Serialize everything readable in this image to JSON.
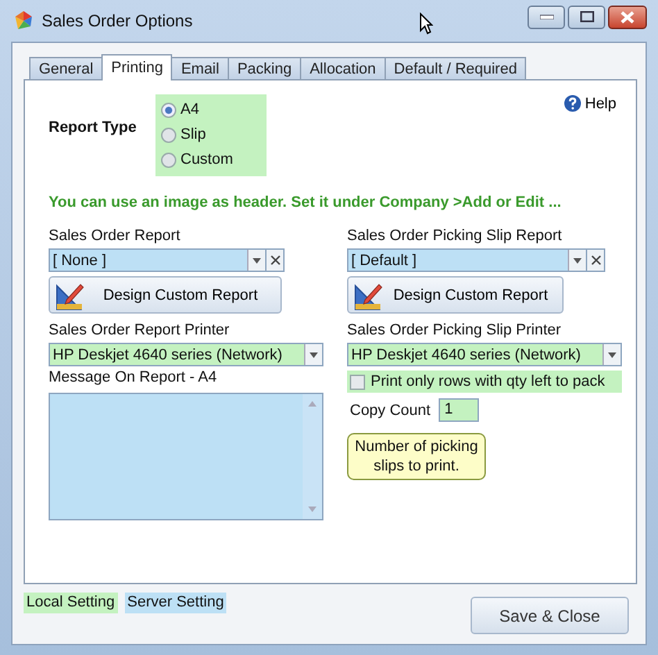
{
  "window": {
    "title": "Sales Order Options"
  },
  "tabs": [
    {
      "label": "General",
      "selected": false
    },
    {
      "label": "Printing",
      "selected": true
    },
    {
      "label": "Email",
      "selected": false
    },
    {
      "label": "Packing",
      "selected": false
    },
    {
      "label": "Allocation",
      "selected": false
    },
    {
      "label": "Default / Required",
      "selected": false
    }
  ],
  "help": {
    "label": "Help"
  },
  "report_type": {
    "label": "Report Type",
    "color": "#c4f2c0",
    "options": [
      {
        "label": "A4",
        "selected": true
      },
      {
        "label": "Slip",
        "selected": false
      },
      {
        "label": "Custom",
        "selected": false
      }
    ]
  },
  "header_hint": "You can use an image as header. Set it under  Company >Add or Edit ...",
  "left": {
    "report": {
      "label": "Sales Order Report",
      "value": "[ None ]",
      "color": "#bde0f5"
    },
    "design_button": "Design Custom Report",
    "printer": {
      "label": "Sales Order Report Printer",
      "value": "HP Deskjet 4640 series (Network)",
      "color": "#c4f2c0"
    },
    "message": {
      "label": "Message On Report - A4",
      "color": "#bde0f5"
    }
  },
  "right": {
    "report": {
      "label": "Sales Order Picking Slip Report",
      "value": "[ Default ]",
      "color": "#bde0f5"
    },
    "design_button": "Design Custom Report",
    "printer": {
      "label": "Sales Order Picking Slip Printer",
      "value": "HP Deskjet 4640 series (Network)",
      "color": "#c4f2c0"
    },
    "only_rows": {
      "label": "Print only rows with qty left to pack",
      "checked": false,
      "color": "#c4f2c0"
    },
    "copy_count": {
      "label": "Copy Count",
      "value": "1",
      "color": "#c4f2c0"
    },
    "tooltip": "Number of picking slips to print."
  },
  "legend": [
    {
      "label": "Local Setting",
      "color": "#c4f2c0"
    },
    {
      "label": "Server Setting",
      "color": "#bde0f5"
    }
  ],
  "buttons": [
    {
      "label": "Save & Close"
    }
  ]
}
